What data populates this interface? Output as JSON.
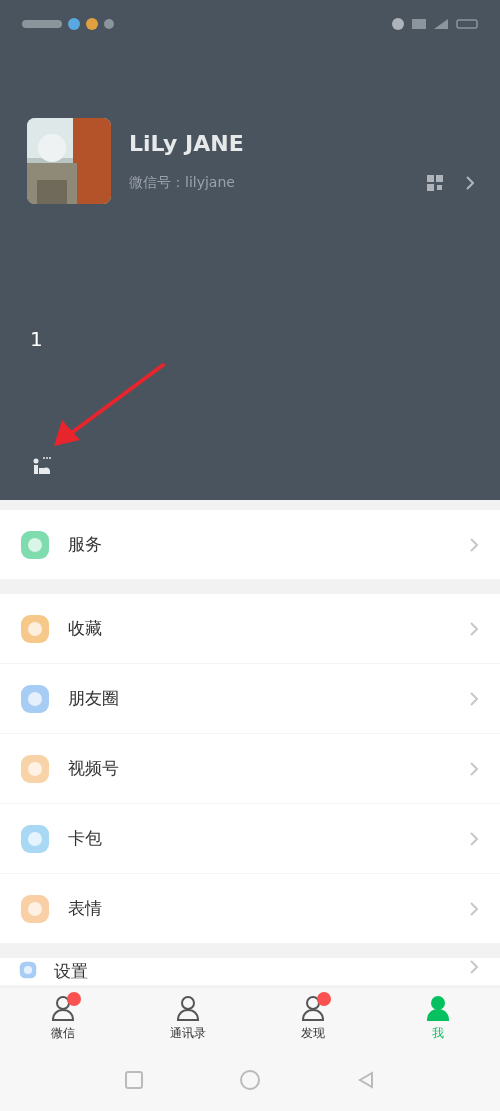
{
  "profile": {
    "name": "LiLy JANE",
    "wechat_id": "微信号：lilyjane"
  },
  "annotation": {
    "step": "1"
  },
  "menu_groups": [
    [
      {
        "label": "服务",
        "color": "#7fdcae"
      }
    ],
    [
      {
        "label": "收藏",
        "color": "#f6c98a"
      },
      {
        "label": "朋友圈",
        "color": "#a8cdf5"
      },
      {
        "label": "视频号",
        "color": "#f8d3a8"
      },
      {
        "label": "卡包",
        "color": "#a9d8f5"
      },
      {
        "label": "表情",
        "color": "#f9cfa5"
      }
    ],
    [
      {
        "label": "设置",
        "color": "#a8cdf5"
      }
    ]
  ],
  "tabs": [
    {
      "label": "微信",
      "selected": false,
      "dot": true
    },
    {
      "label": "通讯录",
      "selected": false,
      "dot": false
    },
    {
      "label": "发现",
      "selected": false,
      "dot": true
    },
    {
      "label": "我",
      "selected": true,
      "dot": false
    }
  ]
}
